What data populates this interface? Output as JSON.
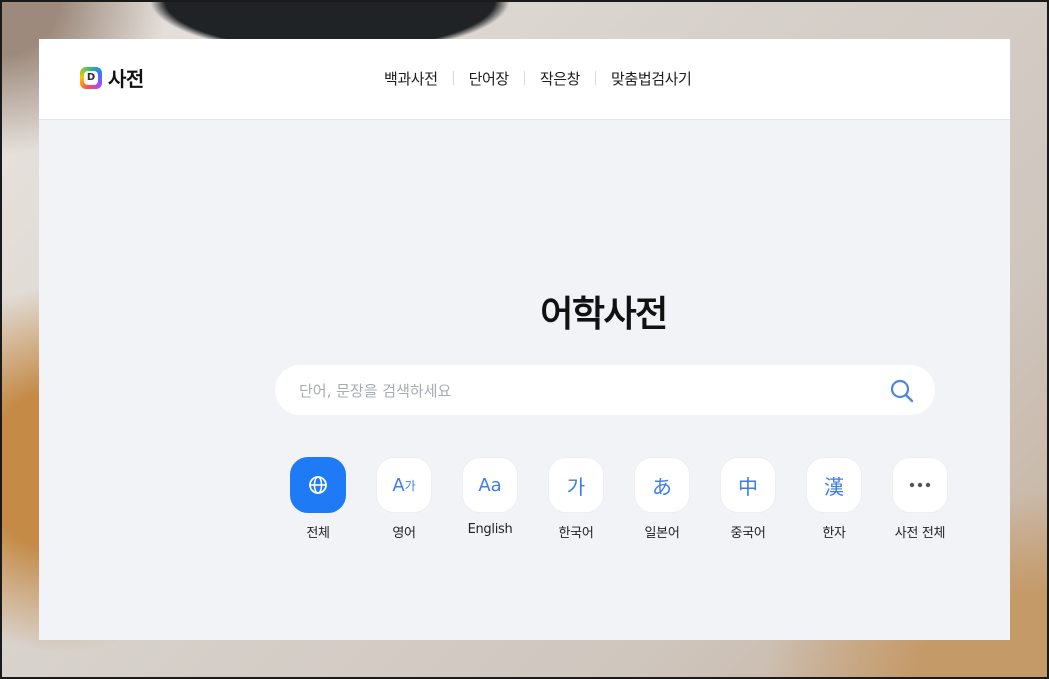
{
  "header": {
    "logo_letter": "D",
    "logo_text": "사전",
    "nav": [
      "백과사전",
      "단어장",
      "작은창",
      "맞춤법검사기"
    ]
  },
  "main": {
    "title": "어학사전",
    "search": {
      "placeholder": "단어, 문장을 검색하세요",
      "value": ""
    },
    "categories": [
      {
        "label": "전체",
        "icon": "globe-icon",
        "active": true
      },
      {
        "label": "영어",
        "icon": "A가"
      },
      {
        "label": "English",
        "icon": "Aa"
      },
      {
        "label": "한국어",
        "icon": "가"
      },
      {
        "label": "일본어",
        "icon": "あ"
      },
      {
        "label": "중국어",
        "icon": "中"
      },
      {
        "label": "한자",
        "icon": "漢"
      },
      {
        "label": "사전 전체",
        "icon": "more-dots-icon"
      }
    ]
  },
  "colors": {
    "accent": "#1f7af5",
    "icon_blue": "#3f7de0",
    "panel_bg": "#f2f3f6"
  }
}
